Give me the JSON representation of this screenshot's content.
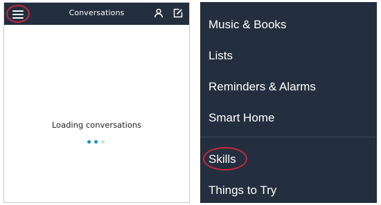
{
  "left_panel": {
    "title": "Conversations",
    "menu_icon": "hamburger-menu-icon",
    "contact_icon": "person-icon",
    "compose_icon": "compose-icon",
    "loading_text": "Loading conversations",
    "loading_dot_colors": [
      "#1a8fd0",
      "#1a8fd0",
      "#c9dfee"
    ]
  },
  "right_menu": {
    "items": [
      {
        "label": "Music & Books"
      },
      {
        "label": "Lists"
      },
      {
        "label": "Reminders & Alarms"
      },
      {
        "label": "Smart Home"
      },
      {
        "label": "Skills"
      },
      {
        "label": "Things to Try"
      }
    ]
  },
  "colors": {
    "topbar_bg": "#232f3e",
    "menu_bg": "#232f3e",
    "highlight": "#c8283c",
    "text_light": "#ffffff"
  }
}
